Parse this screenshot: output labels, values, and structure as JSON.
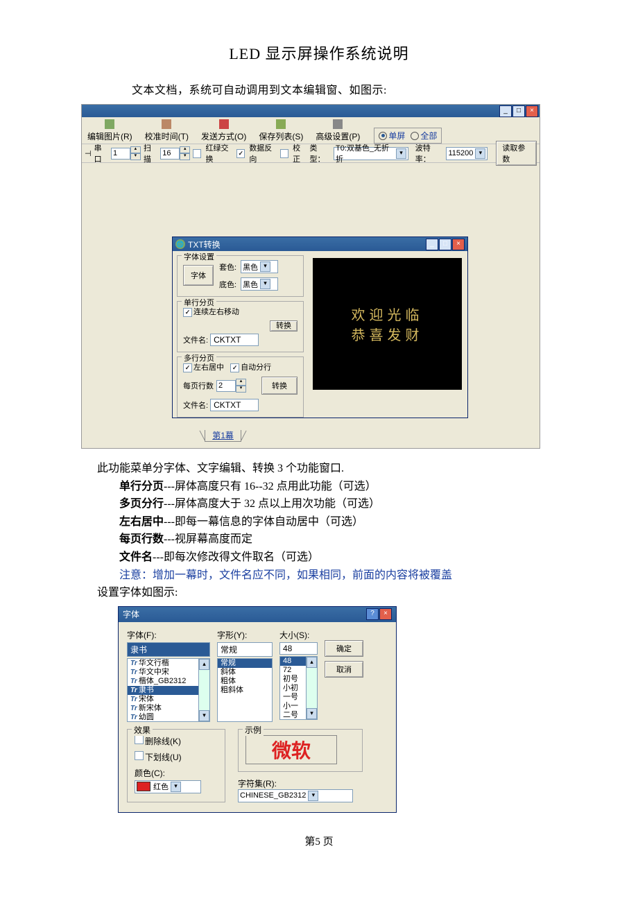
{
  "doc": {
    "title": "LED 显示屏操作系统说明",
    "intro": "文本文档，系统可自动调用到文本编辑窗、如图示:",
    "footer": "第5 页"
  },
  "app": {
    "menus": [
      "编辑图片(R)",
      "校准时间(T)",
      "发送方式(O)",
      "保存列表(S)",
      "高级设置(P)"
    ],
    "radios": {
      "single": "单屏",
      "all": "全部"
    },
    "toolbar": {
      "port_label": "串口",
      "port_value": "1",
      "scan_label": "扫描",
      "scan_value": "16",
      "swap": "红绿交换",
      "datarev": "数据反向",
      "correct": "校正",
      "type_label": "类型：",
      "type_value": "T0:双基色_无折折",
      "baud_label": "波特率：",
      "baud_value": "115200",
      "read": "读取参数"
    },
    "tab": "第1幕"
  },
  "txt_dialog": {
    "title": "TXT转换",
    "fontset": {
      "legend": "字体设置",
      "font_btn": "字体",
      "bg_label": "套色:",
      "bg_value": "黑色",
      "fg_label": "底色:",
      "fg_value": "黑色"
    },
    "single": {
      "legend": "单行分页",
      "move": "连续左右移动",
      "convert": "转换",
      "fname_label": "文件名:",
      "fname_value": "CKTXT"
    },
    "multi": {
      "legend": "多行分页",
      "center": "左右居中",
      "autowrap": "自动分行",
      "lines_label": "每页行数",
      "lines_value": "2",
      "convert": "转换",
      "fname_label": "文件名:",
      "fname_value": "CKTXT"
    },
    "preview": {
      "line1": "欢迎光临",
      "line2": "恭喜发财"
    }
  },
  "desc": {
    "l1": "此功能菜单分字体、文字编辑、转换 3 个功能窗口.",
    "l2a": "单行分页",
    "l2b": "---屏体高度只有 16--32 点用此功能（可选）",
    "l3a": "多页分行",
    "l3b": "---屏体高度大于 32 点以上用次功能（可选）",
    "l4a": "左右居中",
    "l4b": "---即每一幕信息的字体自动居中（可选）",
    "l5a": "每页行数",
    "l5b": "---视屏幕高度而定",
    "l6a": "文件名",
    "l6b": "---即每次修改得文件取名（可选）",
    "note": "注意：增加一幕时，文件名应不同，如果相同，前面的内容将被覆盖",
    "l8": "设置字体如图示:"
  },
  "font_dialog": {
    "title": "字体",
    "font_label": "字体(F):",
    "font_value": "隶书",
    "fonts": [
      "华文行楷",
      "华文中宋",
      "楷体_GB2312",
      "隶书",
      "宋体",
      "新宋体",
      "幼圆"
    ],
    "style_label": "字形(Y):",
    "style_value": "常规",
    "styles": [
      "常规",
      "斜体",
      "粗体",
      "粗斜体"
    ],
    "size_label": "大小(S):",
    "size_value": "48",
    "sizes": [
      "48",
      "72",
      "初号",
      "小初",
      "一号",
      "小一",
      "二号"
    ],
    "ok": "确定",
    "cancel": "取消",
    "effects": {
      "legend": "效果",
      "strike": "删除线(K)",
      "underline": "下划线(U)",
      "color_label": "颜色(C):",
      "color_value": "红色"
    },
    "sample": {
      "legend": "示例",
      "text": "微软"
    },
    "charset": {
      "label": "字符集(R):",
      "value": "CHINESE_GB2312"
    }
  }
}
